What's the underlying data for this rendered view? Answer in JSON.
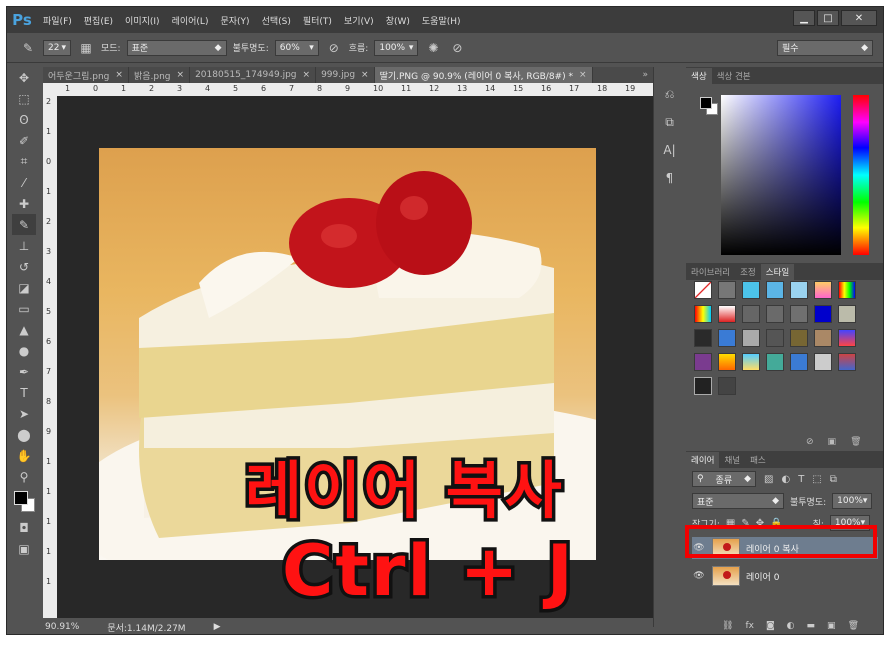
{
  "app": {
    "logo": "Ps"
  },
  "menu": [
    "파일(F)",
    "편집(E)",
    "이미지(I)",
    "레이어(L)",
    "문자(Y)",
    "선택(S)",
    "필터(T)",
    "보기(V)",
    "창(W)",
    "도움말(H)"
  ],
  "window_controls": [
    "▁",
    "□",
    "✕"
  ],
  "options": {
    "brush_size": "22",
    "mode_label": "모드:",
    "mode_value": "표준",
    "opacity_label": "불투명도:",
    "opacity_value": "60%",
    "flow_label": "흐름:",
    "flow_value": "100%",
    "workspace": "필수"
  },
  "tabs": [
    {
      "label": "어두운그림.png",
      "close": "×"
    },
    {
      "label": "밝음.png",
      "close": "×"
    },
    {
      "label": "20180515_174949.jpg",
      "close": "×"
    },
    {
      "label": "999.jpg",
      "close": "×"
    },
    {
      "label": "딸기.PNG @ 90.9% (레이어 0 복사, RGB/8#) *",
      "close": "×"
    }
  ],
  "tabs_overflow": "»",
  "ruler_top": [
    "1",
    "0",
    "1",
    "2",
    "3",
    "4",
    "5",
    "6",
    "7",
    "8",
    "9",
    "10",
    "11",
    "12",
    "13",
    "14",
    "15",
    "16",
    "17",
    "18",
    "19"
  ],
  "ruler_left": [
    "2",
    "1",
    "0",
    "1",
    "2",
    "3",
    "4",
    "5",
    "6",
    "7",
    "8",
    "9",
    "1",
    "1",
    "1",
    "1",
    "1"
  ],
  "status": {
    "zoom": "90.91%",
    "doc": "문서:1.14M/2.27M"
  },
  "panels": {
    "color_tabs": [
      "색상",
      "색상 견본"
    ],
    "style_tabs": [
      "라이브러리",
      "조정",
      "스타일"
    ],
    "layer_tabs": [
      "레이어",
      "채널",
      "패스"
    ],
    "layer_filter": "종류",
    "blend_mode": "표준",
    "opacity_label": "불투명도:",
    "opacity_value": "100%",
    "lock_label": "잠그기:",
    "fill_label": "칠:",
    "fill_value": "100%",
    "layers": [
      {
        "name": "레이어 0 복사",
        "selected": true,
        "visible": "👁"
      },
      {
        "name": "레이어 0",
        "selected": false,
        "visible": "👁"
      }
    ]
  },
  "overlay": {
    "line1": "레이어 복사",
    "line2": "Ctrl + J"
  },
  "colors": {
    "accent": "#ff1212",
    "highlight_box": "#f20000",
    "ps_blue": "#4aa3df"
  }
}
